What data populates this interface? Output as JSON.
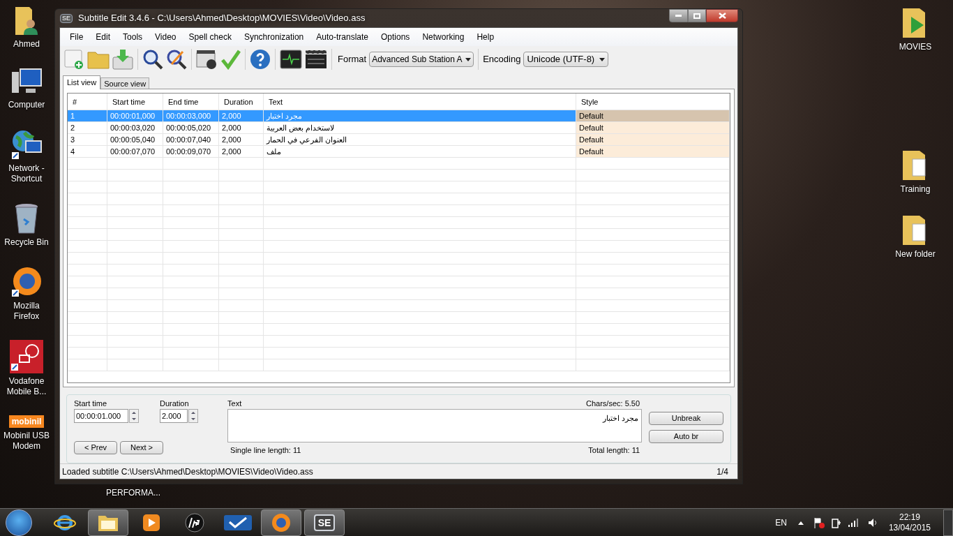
{
  "desktop": {
    "left_icons": [
      {
        "label": "Ahmed",
        "kind": "user"
      },
      {
        "label": "Computer",
        "kind": "computer"
      },
      {
        "label": "Network - Shortcut",
        "kind": "network"
      },
      {
        "label": "Recycle Bin",
        "kind": "bin"
      },
      {
        "label": "Mozilla Firefox",
        "kind": "firefox"
      },
      {
        "label": "Vodafone Mobile B...",
        "kind": "vodafone"
      },
      {
        "label": "Mobinil USB Modem",
        "kind": "mobinil",
        "badge": "mobinil"
      }
    ],
    "right_icons": [
      {
        "label": "MOVIES",
        "kind": "media"
      },
      {
        "label": "Training",
        "kind": "folder"
      },
      {
        "label": "New folder",
        "kind": "folder"
      }
    ],
    "hidden_label": "PERFORMA..."
  },
  "window": {
    "title": "Subtitle Edit 3.4.6 - C:\\Users\\Ahmed\\Desktop\\MOVIES\\Video\\Video.ass",
    "app_badge": "SE",
    "menu": [
      "File",
      "Edit",
      "Tools",
      "Video",
      "Spell check",
      "Synchronization",
      "Auto-translate",
      "Options",
      "Networking",
      "Help"
    ],
    "toolbar": {
      "format_label": "Format",
      "format_value": "Advanced Sub Station A",
      "encoding_label": "Encoding",
      "encoding_value": "Unicode (UTF-8)"
    },
    "tabs": [
      {
        "label": "List view",
        "selected": true
      },
      {
        "label": "Source view",
        "selected": false
      }
    ],
    "table": {
      "columns": [
        "#",
        "Start time",
        "End time",
        "Duration",
        "Text",
        "Style"
      ],
      "rows": [
        {
          "cells": [
            "1",
            "00:00:01,000",
            "00:00:03,000",
            "2,000",
            "مجرد اختبار",
            "Default"
          ],
          "selected": true
        },
        {
          "cells": [
            "2",
            "00:00:03,020",
            "00:00:05,020",
            "2,000",
            "لاستخدام بعض العربية",
            "Default"
          ],
          "selected": false
        },
        {
          "cells": [
            "3",
            "00:00:05,040",
            "00:00:07,040",
            "2,000",
            "العنوان الفرعي في الحمار",
            "Default"
          ],
          "selected": false
        },
        {
          "cells": [
            "4",
            "00:00:07,070",
            "00:00:09,070",
            "2,000",
            "ملف",
            "Default"
          ],
          "selected": false
        }
      ]
    },
    "editor": {
      "start_label": "Start time",
      "start_value": "00:00:01.000",
      "duration_label": "Duration",
      "duration_value": "2.000",
      "text_label": "Text",
      "chars_sec": "Chars/sec: 5.50",
      "text_value": "مجرد اختبار",
      "single_line": "Single line length:  11",
      "total_length": "Total length: 11",
      "buttons": [
        "Unbreak",
        "Auto br"
      ],
      "prev": "< Prev",
      "next": "Next >"
    },
    "status_bar": {
      "text": "Loaded subtitle C:\\Users\\Ahmed\\Desktop\\MOVIES\\Video\\Video.ass",
      "position": "1/4"
    }
  },
  "taskbar": {
    "apps": [
      {
        "kind": "ie",
        "running": false
      },
      {
        "kind": "explorer",
        "running": true
      },
      {
        "kind": "media",
        "running": false
      },
      {
        "kind": "hp",
        "running": false
      },
      {
        "kind": "check",
        "running": false
      },
      {
        "kind": "firefox",
        "running": true
      },
      {
        "kind": "se",
        "running": true,
        "label": "SE"
      }
    ],
    "language": "EN",
    "time": "22:19",
    "date": "13/04/2015"
  }
}
